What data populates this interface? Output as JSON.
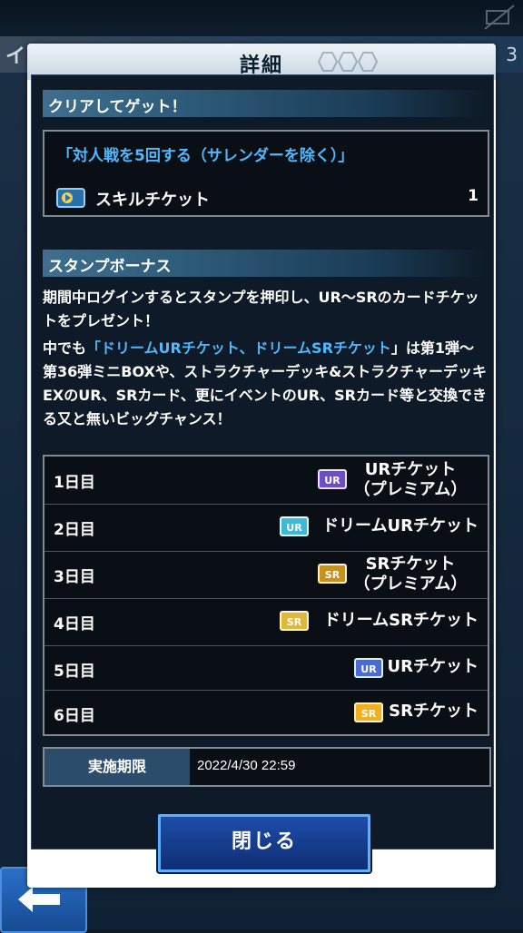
{
  "background": {
    "title_left": "イン",
    "title_right": "3"
  },
  "dialog": {
    "title": "詳細"
  },
  "clear_section": {
    "header": "クリアしてゲット！",
    "mission": "「対人戦を5回する（サレンダーを除く）」",
    "reward": {
      "label": "スキルチケット",
      "count": "1",
      "icon": "skill-ticket-icon"
    }
  },
  "stamp_section": {
    "header": "スタンプボーナス",
    "desc1": "期間中ログインするとスタンプを押印し、UR～SRのカードチケットをプレゼント！",
    "desc2_pre": "中でも",
    "desc2_hl": "「ドリームURチケット、ドリームSRチケット",
    "desc2_post": "」は第1弾～第36弾ミニBOXや、ストラクチャーデッキ&ストラクチャーデッキEXのUR、SRカード、更にイベントのUR、SRカード等と交換できる又と無いビッグチャンス！",
    "rows": [
      {
        "day": "1日目",
        "ticket_line1": "URチケット",
        "ticket_line2": "（プレミアム）",
        "icon": "ur-premium-ticket-icon"
      },
      {
        "day": "2日目",
        "ticket_line1": "ドリームURチケット",
        "ticket_line2": "",
        "icon": "dream-ur-ticket-icon"
      },
      {
        "day": "3日目",
        "ticket_line1": "SRチケット",
        "ticket_line2": "（プレミアム）",
        "icon": "sr-premium-ticket-icon"
      },
      {
        "day": "4日目",
        "ticket_line1": "ドリームSRチケット",
        "ticket_line2": "",
        "icon": "dream-sr-ticket-icon"
      },
      {
        "day": "5日目",
        "ticket_line1": "URチケット",
        "ticket_line2": "",
        "icon": "ur-ticket-icon"
      },
      {
        "day": "6日目",
        "ticket_line1": "SRチケット",
        "ticket_line2": "",
        "icon": "sr-ticket-icon"
      }
    ]
  },
  "period": {
    "label": "実施期限",
    "value": "2022/4/30 22:59"
  },
  "close_button": {
    "label": "閉じる"
  },
  "colors": {
    "highlight": "#4fb8ff",
    "button_border": "#5db0ff"
  }
}
